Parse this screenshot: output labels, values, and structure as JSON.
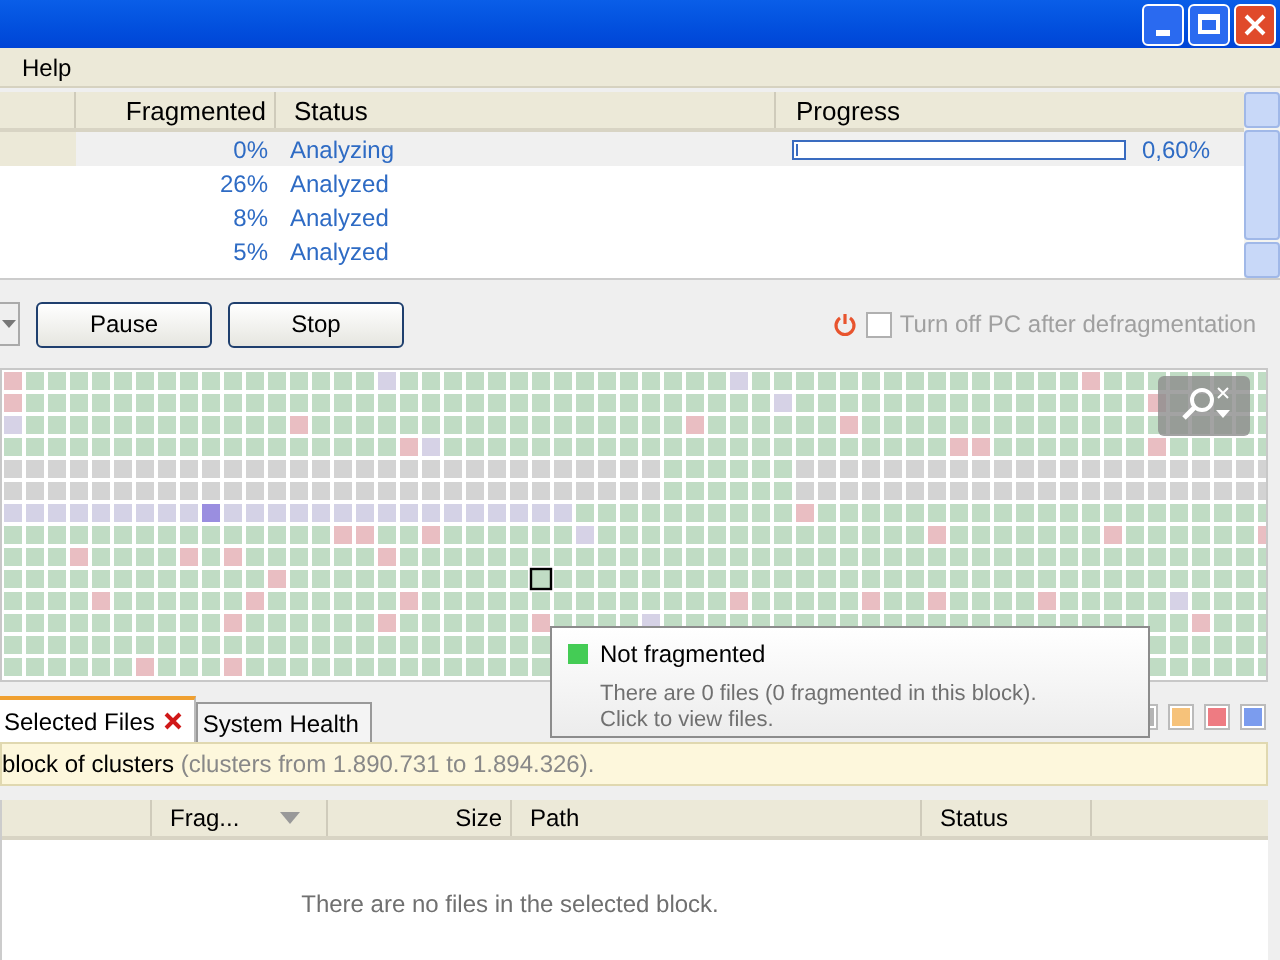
{
  "menu": [
    "Help"
  ],
  "drives_table": {
    "columns": [
      "Fragmented",
      "Status",
      "Progress"
    ],
    "rows": [
      {
        "fragmented": "0%",
        "status": "Analyzing",
        "selected": true,
        "progress": {
          "level": 0.006,
          "reading": "0,60%"
        }
      },
      {
        "fragmented": "26%",
        "status": "Analyzed",
        "selected": false
      },
      {
        "fragmented": "8%",
        "status": "Analyzed",
        "selected": false
      },
      {
        "fragmented": "5%",
        "status": "Analyzed",
        "selected": false
      }
    ]
  },
  "buttons": [
    "Pause",
    "Stop"
  ],
  "shutdown_option": {
    "label": "Turn off PC after defragmentation",
    "checked": false
  },
  "tooltip": {
    "title": "Not fragmented",
    "color": "#44cc55",
    "lines": [
      "There are 0 files (0 fragmented in this block).",
      "Click to view files."
    ]
  },
  "tabs": [
    {
      "label": "Selected Files",
      "selected": true,
      "closable": true
    },
    {
      "label": "System Health",
      "selected": false,
      "closable": false
    }
  ],
  "legend": [
    {
      "color": "#b4b4b4"
    },
    {
      "color": "#f6c27a"
    },
    {
      "color": "#ee7b82"
    },
    {
      "color": "#7b9cee"
    }
  ],
  "info_bar": {
    "text": "block of clusters",
    "detail": "(clusters from 1.890.731 to 1.894.326)."
  },
  "files_table": {
    "columns": [
      {
        "label": "Frag...",
        "sorted": true
      },
      {
        "label": "Size",
        "sorted": false
      },
      {
        "label": "Path",
        "sorted": false
      },
      {
        "label": "Status",
        "sorted": false
      }
    ],
    "empty_message": "There are no files in the selected block."
  }
}
